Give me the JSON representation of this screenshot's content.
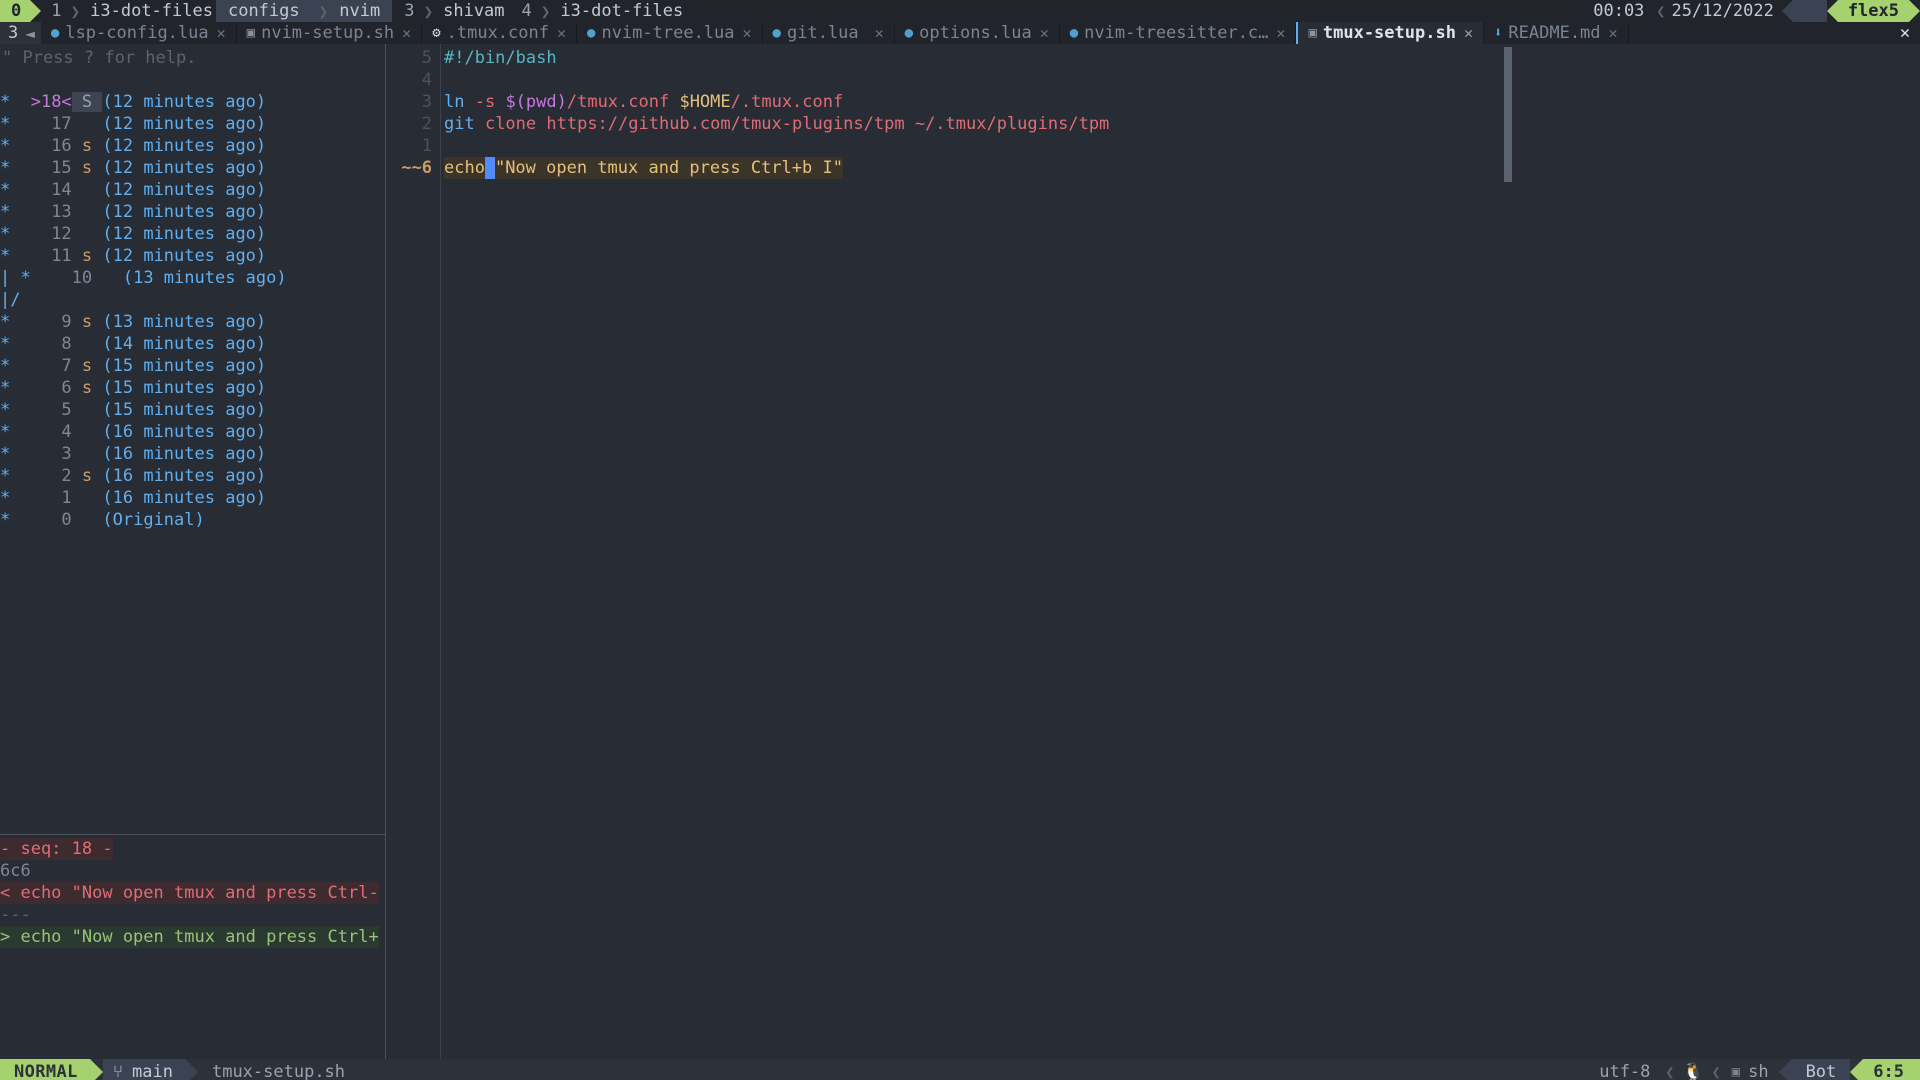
{
  "i3bar": {
    "workspaces": [
      {
        "num": "0",
        "name": "",
        "active": true
      },
      {
        "num": "1",
        "name": "i3-dot-files",
        "active": false
      },
      {
        "num": "",
        "name": "configs",
        "active": true
      },
      {
        "num": "",
        "name": "nvim",
        "active": true
      },
      {
        "num": "3",
        "name": "shivam",
        "active": false
      },
      {
        "num": "4",
        "name": "i3-dot-files",
        "active": false
      }
    ],
    "clock": "00:03",
    "date": "25/12/2022",
    "host": "flex5",
    "sep_icon": "chevron-right"
  },
  "bufferline": {
    "count": "3",
    "back_icon": "arrow-left-circle-icon",
    "close_label": "✕",
    "tabs": [
      {
        "label": "lsp-config.lua",
        "icon": "lua-icon",
        "icon_glyph": "◕",
        "close": "✕",
        "selected": false
      },
      {
        "label": "nvim-setup.sh",
        "icon": "shell-icon",
        "icon_glyph": "▣",
        "close": "✕",
        "selected": false
      },
      {
        "label": ".tmux.conf",
        "icon": "gear-icon",
        "icon_glyph": "⚙",
        "close": "✕",
        "selected": false
      },
      {
        "label": "nvim-tree.lua",
        "icon": "lua-icon",
        "icon_glyph": "◕",
        "close": "✕",
        "selected": false
      },
      {
        "label": "git.lua",
        "icon": "lua-icon",
        "icon_glyph": "◕",
        "close": "✕",
        "selected": false
      },
      {
        "label": "options.lua",
        "icon": "lua-icon",
        "icon_glyph": "◕",
        "close": "✕",
        "selected": false
      },
      {
        "label": "nvim-treesitter.c…",
        "icon": "lua-icon",
        "icon_glyph": "◕",
        "close": "✕",
        "selected": false
      },
      {
        "label": "tmux-setup.sh",
        "icon": "shell-icon",
        "icon_glyph": "▣",
        "close": "✕",
        "selected": true
      },
      {
        "label": "README.md",
        "icon": "markdown-icon",
        "icon_glyph": "⬇",
        "close": "✕",
        "selected": false
      }
    ]
  },
  "undotree": {
    "help": "\" Press ? for help.",
    "rows": [
      {
        "graph": "* ",
        "seq": ">18<",
        "current": true,
        "save": "S",
        "save_current": true,
        "time": "(12 minutes ago)"
      },
      {
        "graph": "* ",
        "seq": "17",
        "current": false,
        "save": "",
        "save_current": false,
        "time": "(12 minutes ago)"
      },
      {
        "graph": "* ",
        "seq": "16",
        "current": false,
        "save": "s",
        "save_current": false,
        "time": "(12 minutes ago)"
      },
      {
        "graph": "* ",
        "seq": "15",
        "current": false,
        "save": "s",
        "save_current": false,
        "time": "(12 minutes ago)"
      },
      {
        "graph": "* ",
        "seq": "14",
        "current": false,
        "save": "",
        "save_current": false,
        "time": "(12 minutes ago)"
      },
      {
        "graph": "* ",
        "seq": "13",
        "current": false,
        "save": "",
        "save_current": false,
        "time": "(12 minutes ago)"
      },
      {
        "graph": "* ",
        "seq": "12",
        "current": false,
        "save": "",
        "save_current": false,
        "time": "(12 minutes ago)"
      },
      {
        "graph": "* ",
        "seq": "11",
        "current": false,
        "save": "s",
        "save_current": false,
        "time": "(12 minutes ago)"
      },
      {
        "graph": "| * ",
        "seq": "10",
        "current": false,
        "save": "",
        "save_current": false,
        "time": "(13 minutes ago)",
        "indent": true
      },
      {
        "graph": "|/",
        "seq": "",
        "current": false,
        "save": "",
        "save_current": false,
        "time": "",
        "branch": true
      },
      {
        "graph": "* ",
        "seq": "9",
        "current": false,
        "save": "s",
        "save_current": false,
        "time": "(13 minutes ago)"
      },
      {
        "graph": "* ",
        "seq": "8",
        "current": false,
        "save": "",
        "save_current": false,
        "time": "(14 minutes ago)"
      },
      {
        "graph": "* ",
        "seq": "7",
        "current": false,
        "save": "s",
        "save_current": false,
        "time": "(15 minutes ago)"
      },
      {
        "graph": "* ",
        "seq": "6",
        "current": false,
        "save": "s",
        "save_current": false,
        "time": "(15 minutes ago)"
      },
      {
        "graph": "* ",
        "seq": "5",
        "current": false,
        "save": "",
        "save_current": false,
        "time": "(15 minutes ago)"
      },
      {
        "graph": "* ",
        "seq": "4",
        "current": false,
        "save": "",
        "save_current": false,
        "time": "(16 minutes ago)"
      },
      {
        "graph": "* ",
        "seq": "3",
        "current": false,
        "save": "",
        "save_current": false,
        "time": "(16 minutes ago)"
      },
      {
        "graph": "* ",
        "seq": "2",
        "current": false,
        "save": "s",
        "save_current": false,
        "time": "(16 minutes ago)"
      },
      {
        "graph": "* ",
        "seq": "1",
        "current": false,
        "save": "",
        "save_current": false,
        "time": "(16 minutes ago)"
      },
      {
        "graph": "* ",
        "seq": "0",
        "current": false,
        "save": "",
        "save_current": false,
        "time": "(Original)"
      }
    ]
  },
  "diff": {
    "header": "- seq: 18 -",
    "index": "6c6",
    "deleted": "< echo \"Now open tmux and press Ctrl-",
    "separator": "---",
    "added": "> echo \"Now open tmux and press Ctrl+"
  },
  "editor": {
    "filename": "tmux-setup.sh",
    "lines": [
      {
        "num": "5",
        "current": false,
        "tokens": [
          {
            "t": "#!/bin/bash",
            "c": "cl-comment"
          }
        ]
      },
      {
        "num": "4",
        "current": false,
        "tokens": []
      },
      {
        "num": "3",
        "current": false,
        "tokens": [
          {
            "t": "ln ",
            "c": "cl-cmd"
          },
          {
            "t": "-s ",
            "c": "cl-flag"
          },
          {
            "t": "$(pwd)",
            "c": "cl-subshell"
          },
          {
            "t": "/tmux.conf ",
            "c": "cl-path"
          },
          {
            "t": "$HOME",
            "c": "cl-var"
          },
          {
            "t": "/.tmux.conf",
            "c": "cl-path"
          }
        ]
      },
      {
        "num": "2",
        "current": false,
        "tokens": [
          {
            "t": "git ",
            "c": "cl-cmd"
          },
          {
            "t": "clone ",
            "c": "cl-flag"
          },
          {
            "t": "https://github.com/tmux-plugins/tpm ~/.tmux/plugins/tpm",
            "c": "cl-path"
          }
        ]
      },
      {
        "num": "1",
        "current": false,
        "tokens": []
      },
      {
        "num": "~~6",
        "current": true,
        "tokens": [
          {
            "t": "echo",
            "c": "cl-builtin"
          },
          {
            "t": " ",
            "c": "cursor"
          },
          {
            "t": "\"Now open tmux and press Ctrl+b I\"",
            "c": "cl-str"
          }
        ]
      }
    ]
  },
  "statusline": {
    "mode": "NORMAL",
    "branch_icon": "git-branch-icon",
    "branch": "main",
    "file": "tmux-setup.sh",
    "encoding": "utf-8",
    "os_icon": "linux-penguin-icon",
    "filetype_icon": "terminal-icon",
    "filetype": "sh",
    "scroll": "Bot",
    "position": "6:5"
  },
  "colors": {
    "bg": "#282c34",
    "bg_dark": "#21252b",
    "accent_green": "#a5d16e",
    "accent_blue": "#61afef",
    "string": "#e5c07b",
    "diff_add": "#98c379",
    "diff_del": "#e06c75"
  }
}
